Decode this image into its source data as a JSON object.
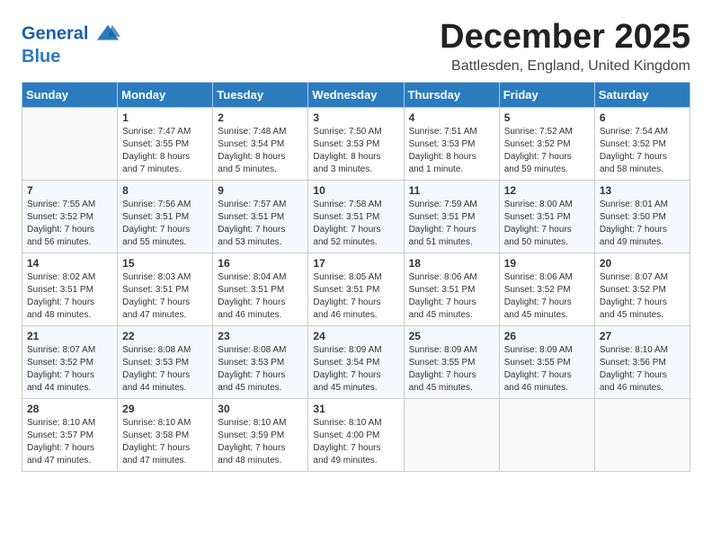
{
  "header": {
    "logo_line1": "General",
    "logo_line2": "Blue",
    "month": "December 2025",
    "location": "Battlesden, England, United Kingdom"
  },
  "weekdays": [
    "Sunday",
    "Monday",
    "Tuesday",
    "Wednesday",
    "Thursday",
    "Friday",
    "Saturday"
  ],
  "weeks": [
    [
      {
        "day": "",
        "info": ""
      },
      {
        "day": "1",
        "info": "Sunrise: 7:47 AM\nSunset: 3:55 PM\nDaylight: 8 hours\nand 7 minutes."
      },
      {
        "day": "2",
        "info": "Sunrise: 7:48 AM\nSunset: 3:54 PM\nDaylight: 8 hours\nand 5 minutes."
      },
      {
        "day": "3",
        "info": "Sunrise: 7:50 AM\nSunset: 3:53 PM\nDaylight: 8 hours\nand 3 minutes."
      },
      {
        "day": "4",
        "info": "Sunrise: 7:51 AM\nSunset: 3:53 PM\nDaylight: 8 hours\nand 1 minute."
      },
      {
        "day": "5",
        "info": "Sunrise: 7:52 AM\nSunset: 3:52 PM\nDaylight: 7 hours\nand 59 minutes."
      },
      {
        "day": "6",
        "info": "Sunrise: 7:54 AM\nSunset: 3:52 PM\nDaylight: 7 hours\nand 58 minutes."
      }
    ],
    [
      {
        "day": "7",
        "info": "Sunrise: 7:55 AM\nSunset: 3:52 PM\nDaylight: 7 hours\nand 56 minutes."
      },
      {
        "day": "8",
        "info": "Sunrise: 7:56 AM\nSunset: 3:51 PM\nDaylight: 7 hours\nand 55 minutes."
      },
      {
        "day": "9",
        "info": "Sunrise: 7:57 AM\nSunset: 3:51 PM\nDaylight: 7 hours\nand 53 minutes."
      },
      {
        "day": "10",
        "info": "Sunrise: 7:58 AM\nSunset: 3:51 PM\nDaylight: 7 hours\nand 52 minutes."
      },
      {
        "day": "11",
        "info": "Sunrise: 7:59 AM\nSunset: 3:51 PM\nDaylight: 7 hours\nand 51 minutes."
      },
      {
        "day": "12",
        "info": "Sunrise: 8:00 AM\nSunset: 3:51 PM\nDaylight: 7 hours\nand 50 minutes."
      },
      {
        "day": "13",
        "info": "Sunrise: 8:01 AM\nSunset: 3:50 PM\nDaylight: 7 hours\nand 49 minutes."
      }
    ],
    [
      {
        "day": "14",
        "info": "Sunrise: 8:02 AM\nSunset: 3:51 PM\nDaylight: 7 hours\nand 48 minutes."
      },
      {
        "day": "15",
        "info": "Sunrise: 8:03 AM\nSunset: 3:51 PM\nDaylight: 7 hours\nand 47 minutes."
      },
      {
        "day": "16",
        "info": "Sunrise: 8:04 AM\nSunset: 3:51 PM\nDaylight: 7 hours\nand 46 minutes."
      },
      {
        "day": "17",
        "info": "Sunrise: 8:05 AM\nSunset: 3:51 PM\nDaylight: 7 hours\nand 46 minutes."
      },
      {
        "day": "18",
        "info": "Sunrise: 8:06 AM\nSunset: 3:51 PM\nDaylight: 7 hours\nand 45 minutes."
      },
      {
        "day": "19",
        "info": "Sunrise: 8:06 AM\nSunset: 3:52 PM\nDaylight: 7 hours\nand 45 minutes."
      },
      {
        "day": "20",
        "info": "Sunrise: 8:07 AM\nSunset: 3:52 PM\nDaylight: 7 hours\nand 45 minutes."
      }
    ],
    [
      {
        "day": "21",
        "info": "Sunrise: 8:07 AM\nSunset: 3:52 PM\nDaylight: 7 hours\nand 44 minutes."
      },
      {
        "day": "22",
        "info": "Sunrise: 8:08 AM\nSunset: 3:53 PM\nDaylight: 7 hours\nand 44 minutes."
      },
      {
        "day": "23",
        "info": "Sunrise: 8:08 AM\nSunset: 3:53 PM\nDaylight: 7 hours\nand 45 minutes."
      },
      {
        "day": "24",
        "info": "Sunrise: 8:09 AM\nSunset: 3:54 PM\nDaylight: 7 hours\nand 45 minutes."
      },
      {
        "day": "25",
        "info": "Sunrise: 8:09 AM\nSunset: 3:55 PM\nDaylight: 7 hours\nand 45 minutes."
      },
      {
        "day": "26",
        "info": "Sunrise: 8:09 AM\nSunset: 3:55 PM\nDaylight: 7 hours\nand 46 minutes."
      },
      {
        "day": "27",
        "info": "Sunrise: 8:10 AM\nSunset: 3:56 PM\nDaylight: 7 hours\nand 46 minutes."
      }
    ],
    [
      {
        "day": "28",
        "info": "Sunrise: 8:10 AM\nSunset: 3:57 PM\nDaylight: 7 hours\nand 47 minutes."
      },
      {
        "day": "29",
        "info": "Sunrise: 8:10 AM\nSunset: 3:58 PM\nDaylight: 7 hours\nand 47 minutes."
      },
      {
        "day": "30",
        "info": "Sunrise: 8:10 AM\nSunset: 3:59 PM\nDaylight: 7 hours\nand 48 minutes."
      },
      {
        "day": "31",
        "info": "Sunrise: 8:10 AM\nSunset: 4:00 PM\nDaylight: 7 hours\nand 49 minutes."
      },
      {
        "day": "",
        "info": ""
      },
      {
        "day": "",
        "info": ""
      },
      {
        "day": "",
        "info": ""
      }
    ]
  ]
}
